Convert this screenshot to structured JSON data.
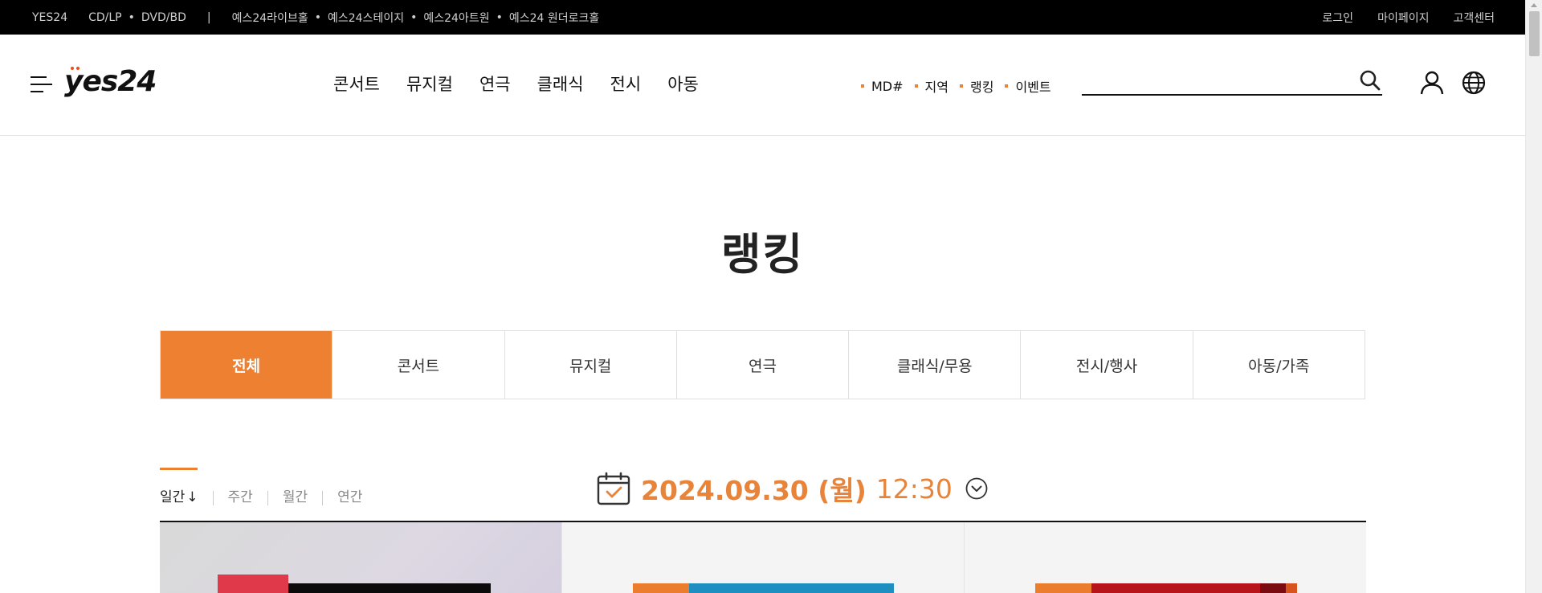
{
  "topbar": {
    "brand": "YES24",
    "links_left": [
      "CD/LP",
      "DVD/BD"
    ],
    "pipe": "|",
    "venues": [
      "예스24라이브홀",
      "예스24스테이지",
      "예스24아트원",
      "예스24 원더로크홀"
    ],
    "links_right": [
      "로그인",
      "마이페이지",
      "고객센터"
    ]
  },
  "header": {
    "logo_text": "yes24",
    "gnb": [
      "콘서트",
      "뮤지컬",
      "연극",
      "클래식",
      "전시",
      "아동"
    ],
    "subnav": [
      "MD#",
      "지역",
      "랭킹",
      "이벤트"
    ],
    "search_placeholder": "",
    "icons": [
      "menu-icon",
      "search-icon",
      "user-icon",
      "globe-icon"
    ]
  },
  "page": {
    "title": "랭킹",
    "tabs": [
      "전체",
      "콘서트",
      "뮤지컬",
      "연극",
      "클래식/무용",
      "전시/행사",
      "아동/가족"
    ],
    "active_tab": "전체",
    "periods": [
      "일간",
      "주간",
      "월간",
      "연간"
    ],
    "active_period": "일간",
    "sort_arrow": "↓",
    "date": "2024.09.30 (월)",
    "time": "12:30"
  },
  "colors": {
    "accent": "#ee8031",
    "topbar_bg": "#000000",
    "text": "#222222"
  }
}
